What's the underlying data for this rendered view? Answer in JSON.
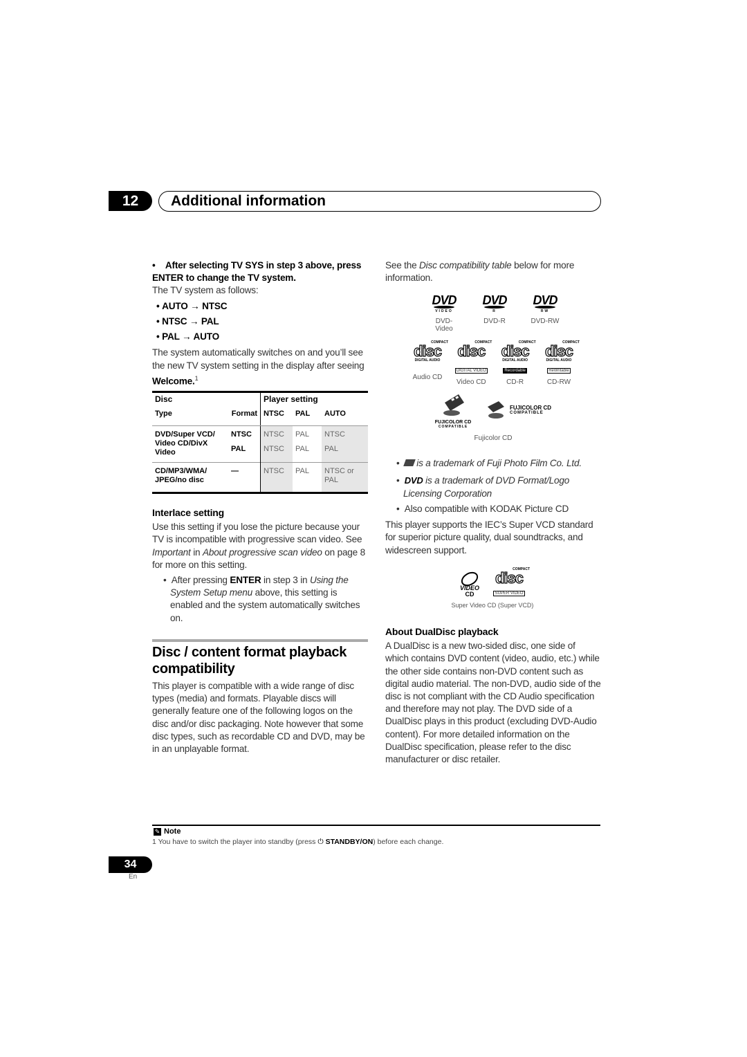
{
  "header": {
    "chapter_number": "12",
    "chapter_title": "Additional information"
  },
  "left": {
    "step_bullet": "•",
    "step_text": "After selecting TV SYS in step 3 above, press ENTER to change the TV system.",
    "tv_intro": "The TV system as follows:",
    "cycle": [
      "AUTO → NTSC",
      "NTSC → PAL",
      "PAL → AUTO"
    ],
    "auto_text": "The system automatically switches on and you’ll see the new TV system setting in the display after seeing",
    "welcome": "Welcome.",
    "footnote_ref": "1",
    "table": {
      "header_disc": "Disc",
      "header_player": "Player setting",
      "col_type": "Type",
      "col_format": "Format",
      "col_ntsc": "NTSC",
      "col_pal": "PAL",
      "col_auto": "AUTO",
      "rows": [
        {
          "type": "DVD/Super VCD/ Video CD/DivX Video",
          "format": "NTSC",
          "ntsc": "NTSC",
          "pal": "PAL",
          "auto": "NTSC"
        },
        {
          "type": "",
          "format": "PAL",
          "ntsc": "NTSC",
          "pal": "PAL",
          "auto": "PAL"
        },
        {
          "type": "CD/MP3/WMA/ JPEG/no disc",
          "format": "—",
          "ntsc": "NTSC",
          "pal": "PAL",
          "auto": "NTSC or PAL"
        }
      ]
    },
    "interlace_heading": "Interlace setting",
    "interlace_p1": "Use this setting if you lose the picture because your TV is incompatible with progressive scan video. See",
    "interlace_p1_i1": "Important",
    "interlace_p1_in": "in",
    "interlace_p1_i2": "About progressive scan video",
    "interlace_p1_end": "on page 8 for more on this setting.",
    "interlace_b_pre": "After pressing",
    "interlace_b_enter": "ENTER",
    "interlace_b_mid": "in step 3 in",
    "interlace_b_i": "Using the System Setup menu",
    "interlace_b_end": "above, this setting is enabled and the system automatically switches on.",
    "compat_heading": "Disc / content format playback compatibility",
    "compat_text": "This player is compatible with a wide range of disc types (media) and formats. Playable discs will generally feature one of the following logos on the disc and/or disc packaging. Note however that some disc types, such as recordable CD and DVD, may be in an unplayable format."
  },
  "right": {
    "see_pre": "See the",
    "see_i": "Disc compatibility table",
    "see_post": "below for more information.",
    "dvd_logos": [
      {
        "mark": "DVD",
        "sub": "VIDEO",
        "caption": "DVD-Video"
      },
      {
        "mark": "DVD",
        "sub": "R",
        "caption": "DVD-R"
      },
      {
        "mark": "DVD",
        "sub": "RW",
        "caption": "DVD-RW"
      }
    ],
    "cd_logos": [
      {
        "top": "COMPACT",
        "mark": "disc",
        "sub": "DIGITAL AUDIO",
        "tag": "",
        "caption": "Audio CD"
      },
      {
        "top": "COMPACT",
        "mark": "disc",
        "sub": "",
        "tag": "DIGITAL VIDEO",
        "caption": "Video CD"
      },
      {
        "top": "COMPACT",
        "mark": "disc",
        "sub": "DIGITAL AUDIO",
        "tag": "Recordable",
        "caption": "CD-R"
      },
      {
        "top": "COMPACT",
        "mark": "disc",
        "sub": "DIGITAL AUDIO",
        "tag": "ReWritable",
        "caption": "CD-RW"
      }
    ],
    "fuji_logo_text": "FUJICOLOR CD",
    "fuji_logo_sub": "COMPATIBLE",
    "fuji_caption": "Fujicolor CD",
    "tm_fuji": "is a trademark of Fuji Photo Film Co. Ltd.",
    "tm_dvd": "is a trademark of DVD Format/Logo Licensing Corporation",
    "kodak": "Also compatible with KODAK Picture CD",
    "svcd_text": "This player supports the IEC’s Super VCD standard for superior picture quality, dual soundtracks, and widescreen support.",
    "svcd_logo_video": "VIDEO",
    "svcd_logo_cd": "CD",
    "svcd_logo_top": "COMPACT",
    "svcd_logo_mark": "disc",
    "svcd_logo_tag": "SUPER VIDEO",
    "svcd_caption": "Super Video CD (Super VCD)",
    "dualdisc_heading": "About DualDisc playback",
    "dualdisc_text": "A DualDisc is a new two-sided disc, one side of which contains DVD content (video, audio, etc.) while the other side contains non-DVD content such as digital audio material. The non-DVD, audio side of the disc is not compliant with the CD Audio specification and therefore may not play. The DVD side of a DualDisc plays in this product (excluding DVD-Audio content). For more detailed information on the DualDisc specification, please refer to the disc manufacturer or disc retailer."
  },
  "note": {
    "label": "Note",
    "num": "1",
    "pre": "You have to switch the player into standby (press",
    "button": "STANDBY/ON",
    "post": ") before each change."
  },
  "footer": {
    "page_number": "34",
    "language": "En"
  }
}
